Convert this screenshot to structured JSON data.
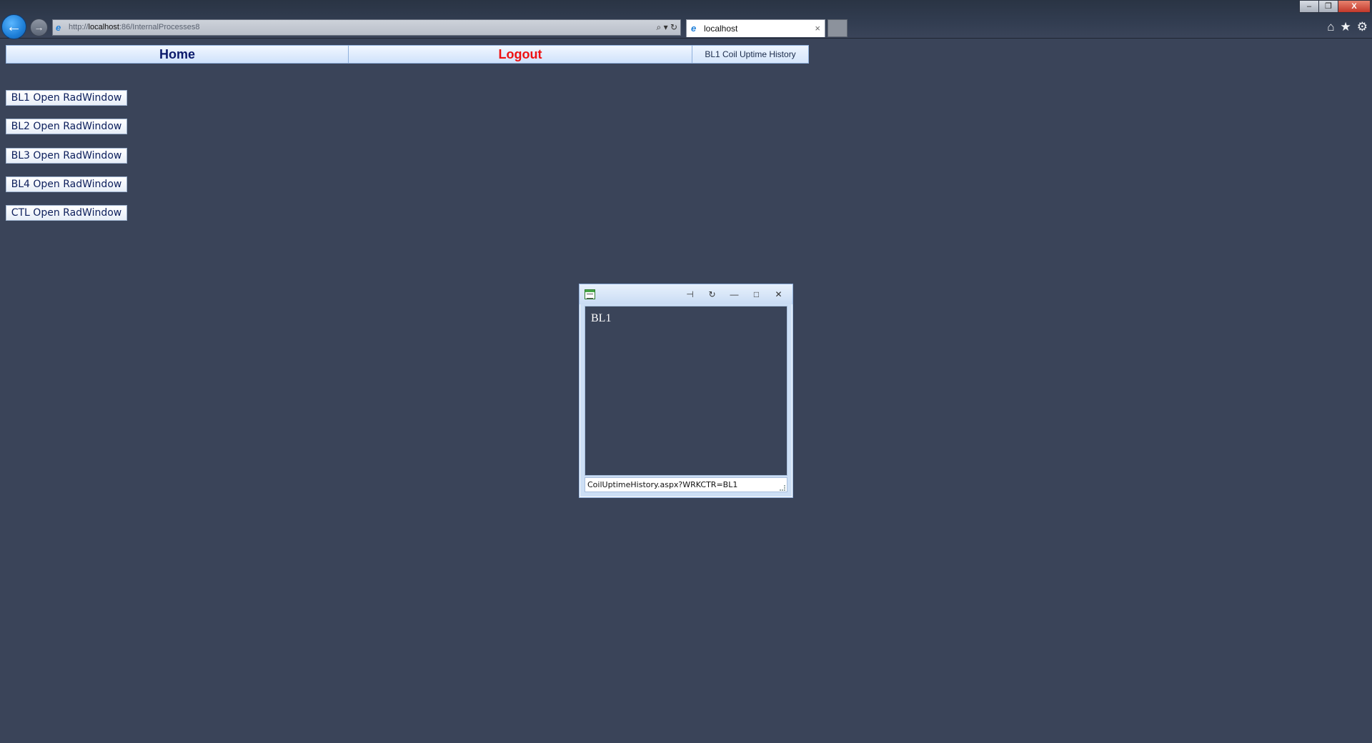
{
  "browser": {
    "url_prefix": "http://",
    "url_host": "localhost",
    "url_path": ":86/InternalProcesses8",
    "tab_title": "localhost",
    "tab_close": "×",
    "address_tools": "⌕ ▾ ↻",
    "back_icon": "←",
    "forward_icon": "→",
    "ie_icon": "e",
    "window_buttons": {
      "minimize": "–",
      "restore": "❐",
      "close": "X"
    },
    "tools": {
      "home": "⌂",
      "favorites": "★",
      "settings": "⚙"
    }
  },
  "menu": {
    "home_label": "Home",
    "logout_label": "Logout",
    "history_label": "BL1 Coil Uptime History"
  },
  "buttons": [
    {
      "label": "BL1 Open RadWindow"
    },
    {
      "label": "BL2 Open RadWindow"
    },
    {
      "label": "BL3 Open RadWindow"
    },
    {
      "label": "BL4 Open RadWindow"
    },
    {
      "label": "CTL Open RadWindow"
    }
  ],
  "radwindow": {
    "content_text": "BL1",
    "status_text": "CoilUptimeHistory.aspx?WRKCTR=BL1",
    "actions": {
      "pin": "⊣",
      "reload": "↻",
      "minimize": "—",
      "maximize": "□",
      "close": "✕"
    }
  },
  "colors": {
    "page_background": "#3a4459",
    "home_text": "#0b1a6b",
    "logout_text": "#ee1111",
    "button_text": "#0d1f5c"
  }
}
